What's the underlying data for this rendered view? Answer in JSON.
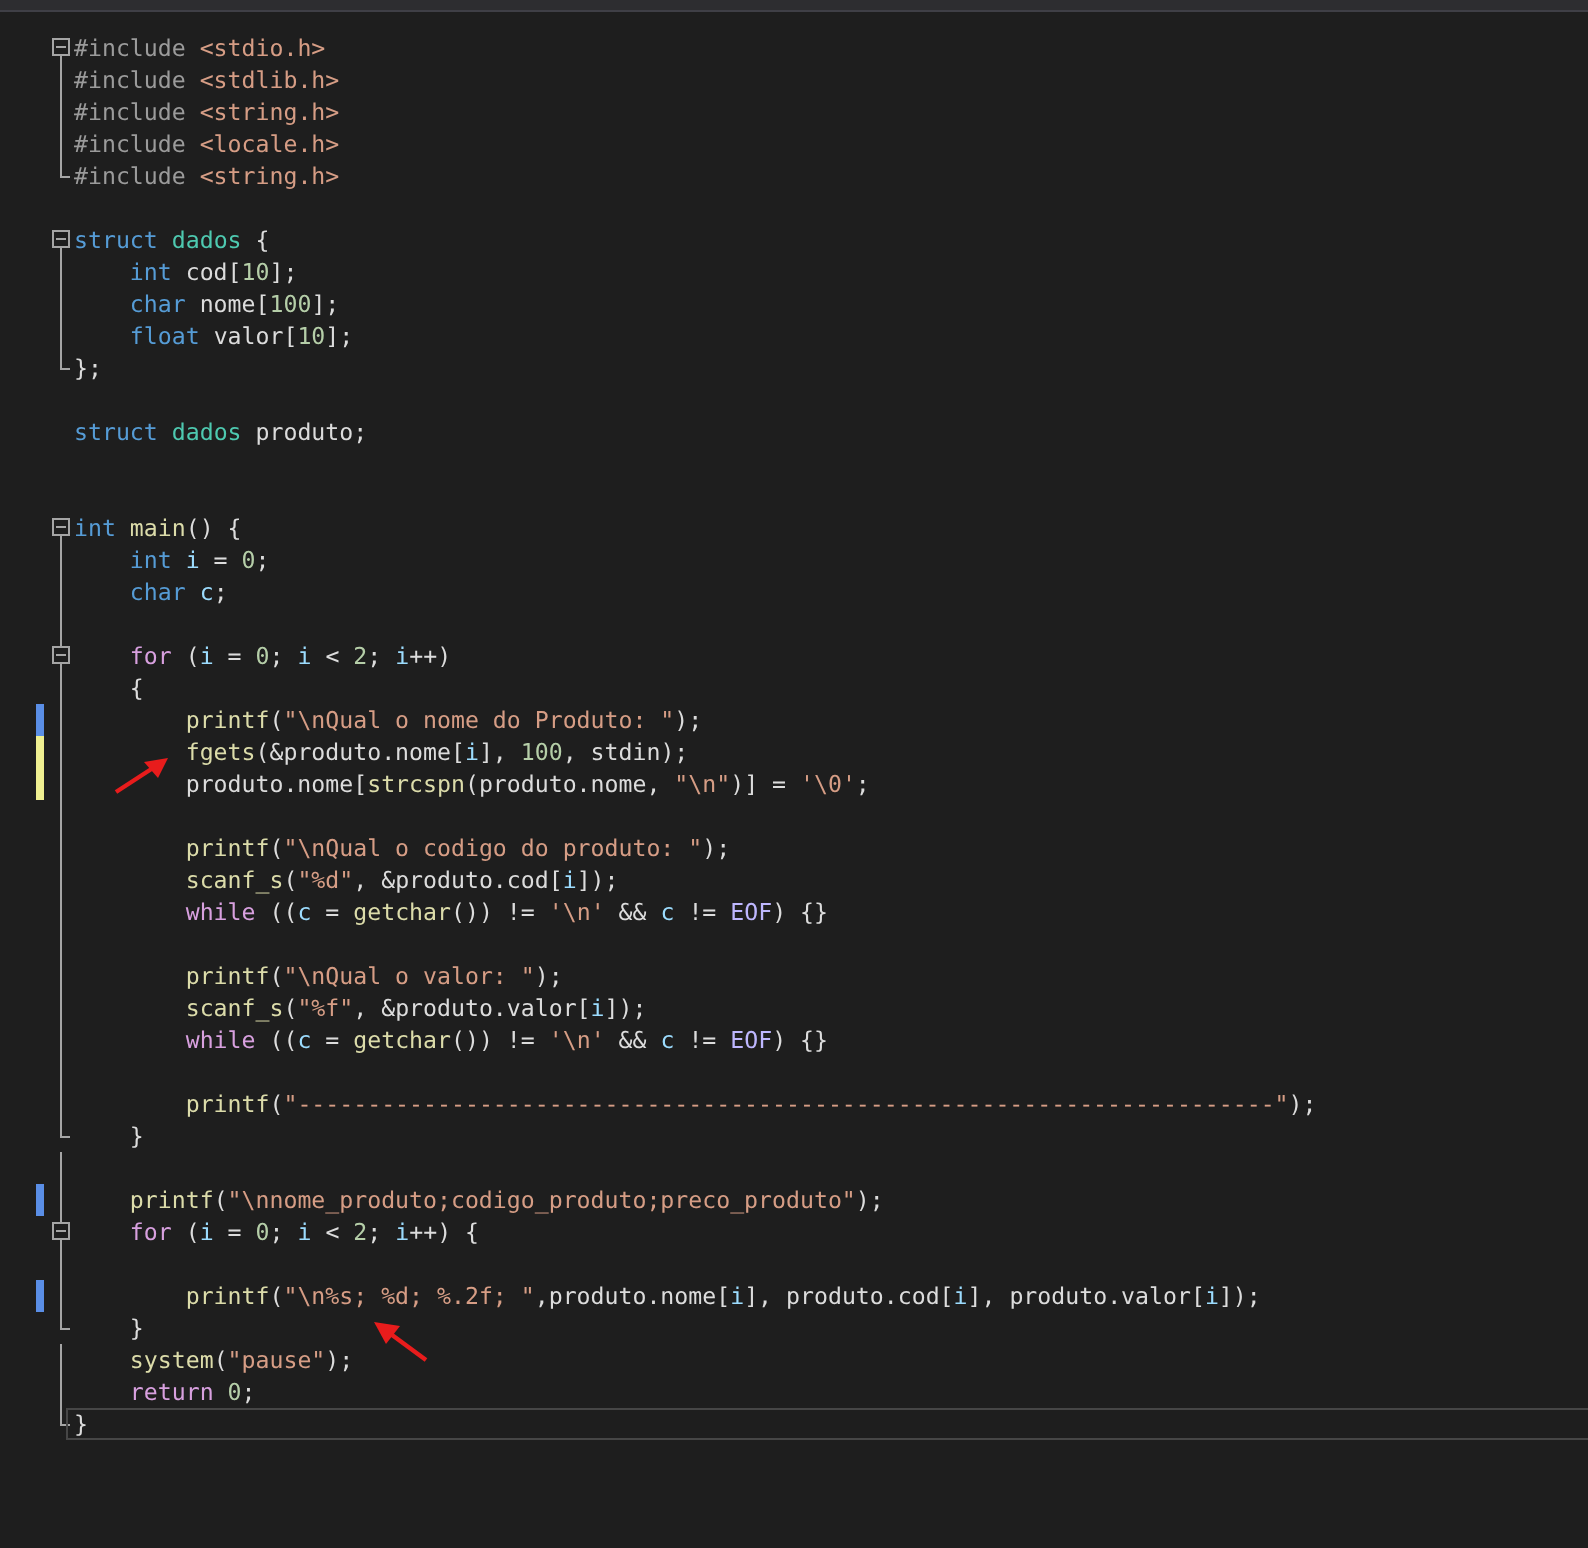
{
  "editor": {
    "lines": [
      {
        "fold_toggle": true,
        "tokens": [
          {
            "kind": "pre",
            "text": "#include "
          },
          {
            "kind": "str",
            "text": "<stdio.h>"
          }
        ]
      },
      {
        "fold_guide": true,
        "tokens": [
          {
            "kind": "pre",
            "text": "#include "
          },
          {
            "kind": "str",
            "text": "<stdlib.h>"
          }
        ]
      },
      {
        "fold_guide": true,
        "tokens": [
          {
            "kind": "pre",
            "text": "#include "
          },
          {
            "kind": "str",
            "text": "<string.h>"
          }
        ]
      },
      {
        "fold_guide": true,
        "tokens": [
          {
            "kind": "pre",
            "text": "#include "
          },
          {
            "kind": "str",
            "text": "<locale.h>"
          }
        ]
      },
      {
        "fold_end": true,
        "tokens": [
          {
            "kind": "pre",
            "text": "#include "
          },
          {
            "kind": "str",
            "text": "<string.h>"
          }
        ]
      },
      {
        "fold_guide": false
      },
      {
        "fold_toggle": true,
        "tokens": [
          {
            "kind": "kw",
            "text": "struct "
          },
          {
            "kind": "type",
            "text": "dados"
          },
          {
            "kind": "plain",
            "text": " {"
          }
        ]
      },
      {
        "fold_guide": true,
        "tokens": [
          {
            "kind": "kw",
            "text": "    int "
          },
          {
            "kind": "plain",
            "text": "cod["
          },
          {
            "kind": "num",
            "text": "10"
          },
          {
            "kind": "plain",
            "text": "];"
          }
        ]
      },
      {
        "fold_guide": true,
        "tokens": [
          {
            "kind": "kw",
            "text": "    char "
          },
          {
            "kind": "plain",
            "text": "nome["
          },
          {
            "kind": "num",
            "text": "100"
          },
          {
            "kind": "plain",
            "text": "];"
          }
        ]
      },
      {
        "fold_guide": true,
        "tokens": [
          {
            "kind": "kw",
            "text": "    float "
          },
          {
            "kind": "plain",
            "text": "valor["
          },
          {
            "kind": "num",
            "text": "10"
          },
          {
            "kind": "plain",
            "text": "];"
          }
        ]
      },
      {
        "fold_end": true,
        "tokens": [
          {
            "kind": "plain",
            "text": "};"
          }
        ]
      },
      {
        "fold_guide": false
      },
      {
        "tokens": [
          {
            "kind": "kw",
            "text": "struct "
          },
          {
            "kind": "type",
            "text": "dados "
          },
          {
            "kind": "plain",
            "text": "produto;"
          }
        ]
      },
      {
        "fold_guide": false
      },
      {
        "fold_guide": false
      },
      {
        "fold_toggle": true,
        "tokens": [
          {
            "kind": "kw",
            "text": "int "
          },
          {
            "kind": "fn",
            "text": "main"
          },
          {
            "kind": "plain",
            "text": "() {"
          }
        ]
      },
      {
        "fold_guide": true,
        "tokens": [
          {
            "kind": "kw",
            "text": "    int "
          },
          {
            "kind": "var",
            "text": "i"
          },
          {
            "kind": "plain",
            "text": " = "
          },
          {
            "kind": "num",
            "text": "0"
          },
          {
            "kind": "plain",
            "text": ";"
          }
        ]
      },
      {
        "fold_guide": true,
        "tokens": [
          {
            "kind": "kw",
            "text": "    char "
          },
          {
            "kind": "var",
            "text": "c"
          },
          {
            "kind": "plain",
            "text": ";"
          }
        ]
      },
      {
        "fold_guide": true
      },
      {
        "fold_toggle": true,
        "tokens": [
          {
            "kind": "ctl",
            "text": "    for"
          },
          {
            "kind": "plain",
            "text": " ("
          },
          {
            "kind": "var",
            "text": "i"
          },
          {
            "kind": "plain",
            "text": " = "
          },
          {
            "kind": "num",
            "text": "0"
          },
          {
            "kind": "plain",
            "text": "; "
          },
          {
            "kind": "var",
            "text": "i"
          },
          {
            "kind": "plain",
            "text": " < "
          },
          {
            "kind": "num",
            "text": "2"
          },
          {
            "kind": "plain",
            "text": "; "
          },
          {
            "kind": "var",
            "text": "i"
          },
          {
            "kind": "plain",
            "text": "++)"
          }
        ]
      },
      {
        "fold_guide": true,
        "tokens": [
          {
            "kind": "plain",
            "text": "    {"
          }
        ]
      },
      {
        "fold_guide": true,
        "changed": true,
        "saved": true,
        "tokens": [
          {
            "kind": "fn",
            "text": "        printf"
          },
          {
            "kind": "plain",
            "text": "("
          },
          {
            "kind": "str",
            "text": "\"\\nQual o nome do Produto: \""
          },
          {
            "kind": "plain",
            "text": ");"
          }
        ]
      },
      {
        "fold_guide": true,
        "changed": true,
        "saved": false,
        "tokens": [
          {
            "kind": "fn",
            "text": "        fgets"
          },
          {
            "kind": "plain",
            "text": "(&produto.nome["
          },
          {
            "kind": "var",
            "text": "i"
          },
          {
            "kind": "plain",
            "text": "], "
          },
          {
            "kind": "num",
            "text": "100"
          },
          {
            "kind": "plain",
            "text": ", stdin);"
          }
        ]
      },
      {
        "fold_guide": true,
        "changed": true,
        "saved": false,
        "arrow": {
          "kind": "up-right"
        },
        "tokens": [
          {
            "kind": "plain",
            "text": "        produto.nome["
          },
          {
            "kind": "fn",
            "text": "strcspn"
          },
          {
            "kind": "plain",
            "text": "(produto.nome, "
          },
          {
            "kind": "str",
            "text": "\"\\n\""
          },
          {
            "kind": "plain",
            "text": ")] = "
          },
          {
            "kind": "str",
            "text": "'\\0'"
          },
          {
            "kind": "plain",
            "text": ";"
          }
        ]
      },
      {
        "fold_guide": true
      },
      {
        "fold_guide": true,
        "tokens": [
          {
            "kind": "fn",
            "text": "        printf"
          },
          {
            "kind": "plain",
            "text": "("
          },
          {
            "kind": "str",
            "text": "\"\\nQual o codigo do produto: \""
          },
          {
            "kind": "plain",
            "text": ");"
          }
        ]
      },
      {
        "fold_guide": true,
        "tokens": [
          {
            "kind": "fn",
            "text": "        scanf_s"
          },
          {
            "kind": "plain",
            "text": "("
          },
          {
            "kind": "str",
            "text": "\"%d\""
          },
          {
            "kind": "plain",
            "text": ", &produto.cod["
          },
          {
            "kind": "var",
            "text": "i"
          },
          {
            "kind": "plain",
            "text": "]);"
          }
        ]
      },
      {
        "fold_guide": true,
        "tokens": [
          {
            "kind": "ctl",
            "text": "        while"
          },
          {
            "kind": "plain",
            "text": " (("
          },
          {
            "kind": "var",
            "text": "c"
          },
          {
            "kind": "plain",
            "text": " = "
          },
          {
            "kind": "fn",
            "text": "getchar"
          },
          {
            "kind": "plain",
            "text": "()) != "
          },
          {
            "kind": "str",
            "text": "'\\n'"
          },
          {
            "kind": "plain",
            "text": " && "
          },
          {
            "kind": "var",
            "text": "c"
          },
          {
            "kind": "plain",
            "text": " != "
          },
          {
            "kind": "macro",
            "text": "EOF"
          },
          {
            "kind": "plain",
            "text": ") {}"
          }
        ]
      },
      {
        "fold_guide": true
      },
      {
        "fold_guide": true,
        "tokens": [
          {
            "kind": "fn",
            "text": "        printf"
          },
          {
            "kind": "plain",
            "text": "("
          },
          {
            "kind": "str",
            "text": "\"\\nQual o valor: \""
          },
          {
            "kind": "plain",
            "text": ");"
          }
        ]
      },
      {
        "fold_guide": true,
        "tokens": [
          {
            "kind": "fn",
            "text": "        scanf_s"
          },
          {
            "kind": "plain",
            "text": "("
          },
          {
            "kind": "str",
            "text": "\"%f\""
          },
          {
            "kind": "plain",
            "text": ", &produto.valor["
          },
          {
            "kind": "var",
            "text": "i"
          },
          {
            "kind": "plain",
            "text": "]);"
          }
        ]
      },
      {
        "fold_guide": true,
        "tokens": [
          {
            "kind": "ctl",
            "text": "        while"
          },
          {
            "kind": "plain",
            "text": " (("
          },
          {
            "kind": "var",
            "text": "c"
          },
          {
            "kind": "plain",
            "text": " = "
          },
          {
            "kind": "fn",
            "text": "getchar"
          },
          {
            "kind": "plain",
            "text": "()) != "
          },
          {
            "kind": "str",
            "text": "'\\n'"
          },
          {
            "kind": "plain",
            "text": " && "
          },
          {
            "kind": "var",
            "text": "c"
          },
          {
            "kind": "plain",
            "text": " != "
          },
          {
            "kind": "macro",
            "text": "EOF"
          },
          {
            "kind": "plain",
            "text": ") {}"
          }
        ]
      },
      {
        "fold_guide": true
      },
      {
        "fold_guide": true,
        "tokens": [
          {
            "kind": "fn",
            "text": "        printf"
          },
          {
            "kind": "plain",
            "text": "("
          },
          {
            "kind": "str",
            "text": "\"----------------------------------------------------------------------\""
          },
          {
            "kind": "plain",
            "text": ");"
          }
        ]
      },
      {
        "fold_end": true,
        "tokens": [
          {
            "kind": "plain",
            "text": "    }"
          }
        ]
      },
      {
        "fold_guide": true
      },
      {
        "fold_guide": true,
        "changed": true,
        "saved": true,
        "tokens": [
          {
            "kind": "fn",
            "text": "    printf"
          },
          {
            "kind": "plain",
            "text": "("
          },
          {
            "kind": "str",
            "text": "\"\\nnome_produto;codigo_produto;preco_produto\""
          },
          {
            "kind": "plain",
            "text": ");"
          }
        ]
      },
      {
        "fold_toggle": true,
        "tokens": [
          {
            "kind": "ctl",
            "text": "    for"
          },
          {
            "kind": "plain",
            "text": " ("
          },
          {
            "kind": "var",
            "text": "i"
          },
          {
            "kind": "plain",
            "text": " = "
          },
          {
            "kind": "num",
            "text": "0"
          },
          {
            "kind": "plain",
            "text": "; "
          },
          {
            "kind": "var",
            "text": "i"
          },
          {
            "kind": "plain",
            "text": " < "
          },
          {
            "kind": "num",
            "text": "2"
          },
          {
            "kind": "plain",
            "text": "; "
          },
          {
            "kind": "var",
            "text": "i"
          },
          {
            "kind": "plain",
            "text": "++) {"
          }
        ]
      },
      {
        "fold_guide": true
      },
      {
        "fold_guide": true,
        "changed": true,
        "saved": true,
        "tokens": [
          {
            "kind": "fn",
            "text": "        printf"
          },
          {
            "kind": "plain",
            "text": "("
          },
          {
            "kind": "str",
            "text": "\"\\n%s; %d; %.2f; \""
          },
          {
            "kind": "plain",
            "text": ",produto.nome["
          },
          {
            "kind": "var",
            "text": "i"
          },
          {
            "kind": "plain",
            "text": "], produto.cod["
          },
          {
            "kind": "var",
            "text": "i"
          },
          {
            "kind": "plain",
            "text": "], produto.valor["
          },
          {
            "kind": "var",
            "text": "i"
          },
          {
            "kind": "plain",
            "text": "]);"
          }
        ]
      },
      {
        "fold_end": true,
        "tokens": [
          {
            "kind": "plain",
            "text": "    }"
          }
        ]
      },
      {
        "fold_guide": true,
        "arrow": {
          "kind": "up-left"
        },
        "tokens": [
          {
            "kind": "fn",
            "text": "    system"
          },
          {
            "kind": "plain",
            "text": "("
          },
          {
            "kind": "str",
            "text": "\"pause\""
          },
          {
            "kind": "plain",
            "text": ");"
          }
        ]
      },
      {
        "fold_guide": true,
        "tokens": [
          {
            "kind": "ctl",
            "text": "    return "
          },
          {
            "kind": "num",
            "text": "0"
          },
          {
            "kind": "plain",
            "text": ";"
          }
        ]
      },
      {
        "fold_end": true,
        "current": true,
        "tokens": [
          {
            "kind": "plain",
            "text": "}"
          }
        ]
      }
    ]
  }
}
